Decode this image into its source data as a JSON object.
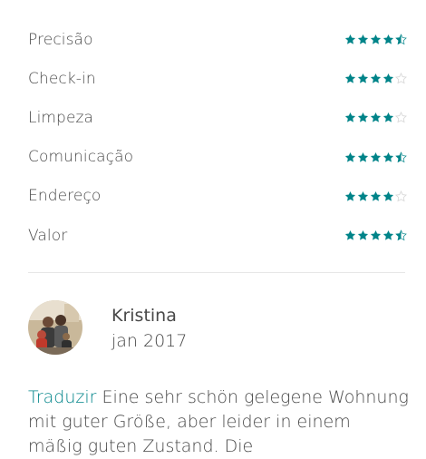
{
  "ratings": [
    {
      "label": "Precisão",
      "stars": 4.5
    },
    {
      "label": "Check-in",
      "stars": 4
    },
    {
      "label": "Limpeza",
      "stars": 4
    },
    {
      "label": "Comunicação",
      "stars": 4.5
    },
    {
      "label": "Endereço",
      "stars": 4
    },
    {
      "label": "Valor",
      "stars": 4.5
    }
  ],
  "colors": {
    "star_filled": "#008489",
    "star_empty": "#d8d8d8",
    "accent": "#008489"
  },
  "review": {
    "reviewer_name": "Kristina",
    "date": "jan 2017",
    "translate_label": "Traduzir",
    "text": "Eine sehr schön gelegene Wohnung mit guter Größe, aber leider in einem mäßig guten Zustand. Die"
  }
}
